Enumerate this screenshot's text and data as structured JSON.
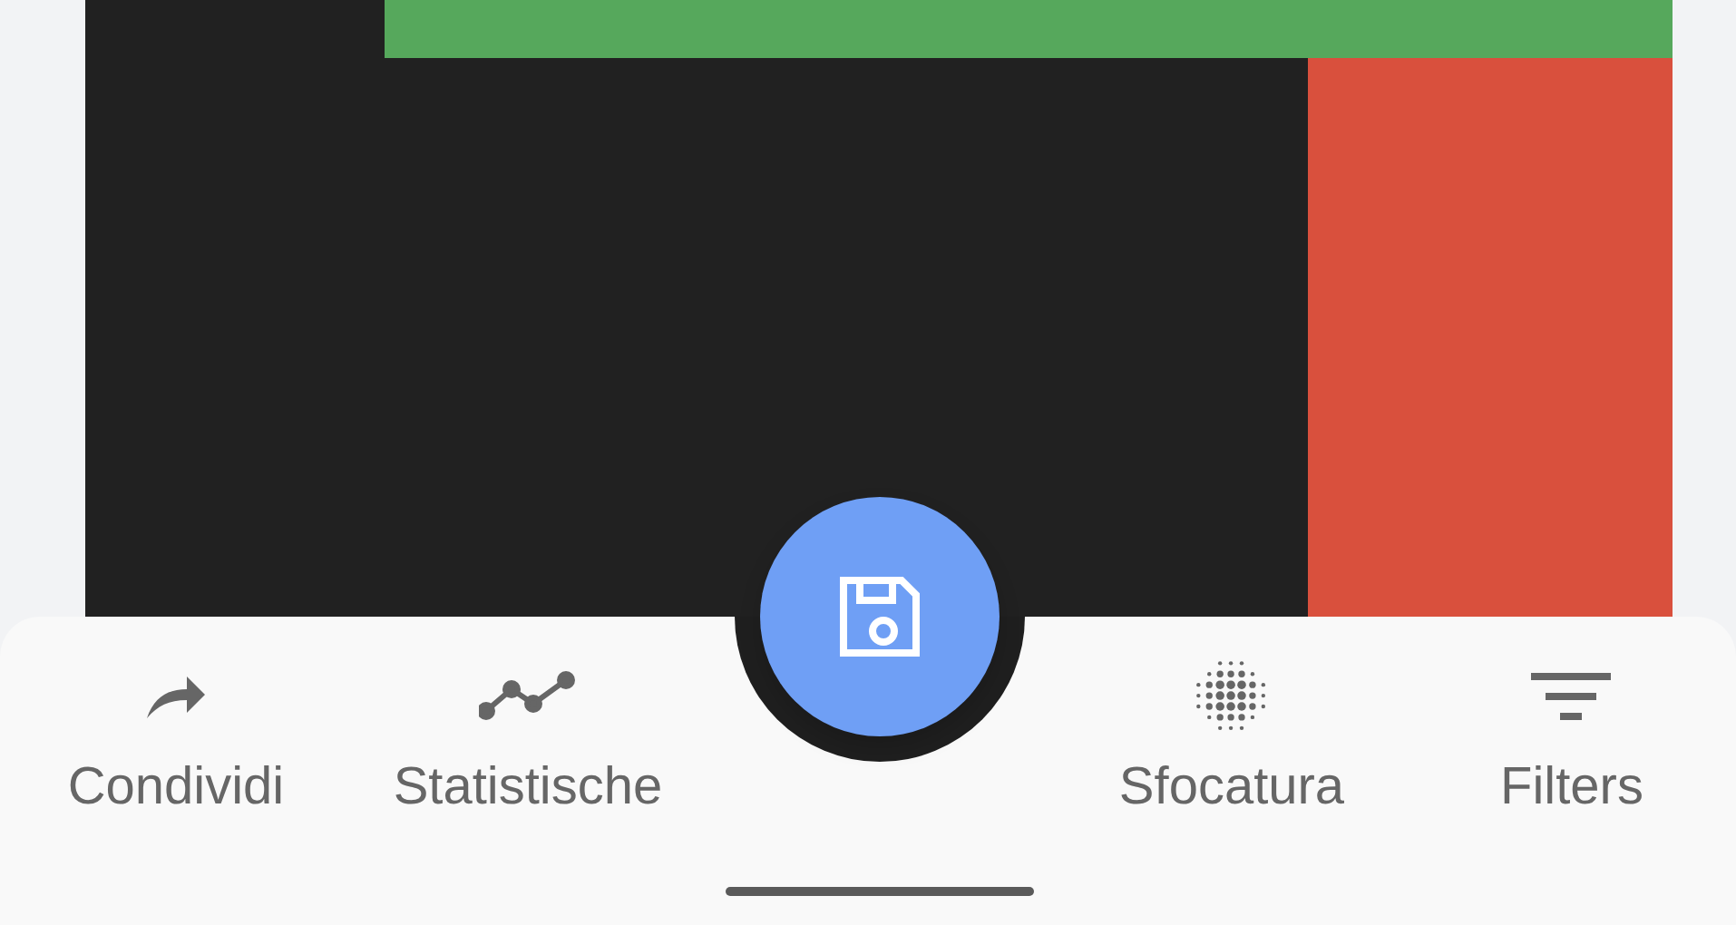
{
  "bottom_bar": {
    "items": [
      {
        "kind": "share",
        "label": "Condividi"
      },
      {
        "kind": "stats",
        "label": "Statistische"
      },
      {
        "kind": "spacer"
      },
      {
        "kind": "blur",
        "label": "Sfocatura"
      },
      {
        "kind": "filter",
        "label": "Filters"
      }
    ],
    "fab": {
      "kind": "save"
    }
  }
}
